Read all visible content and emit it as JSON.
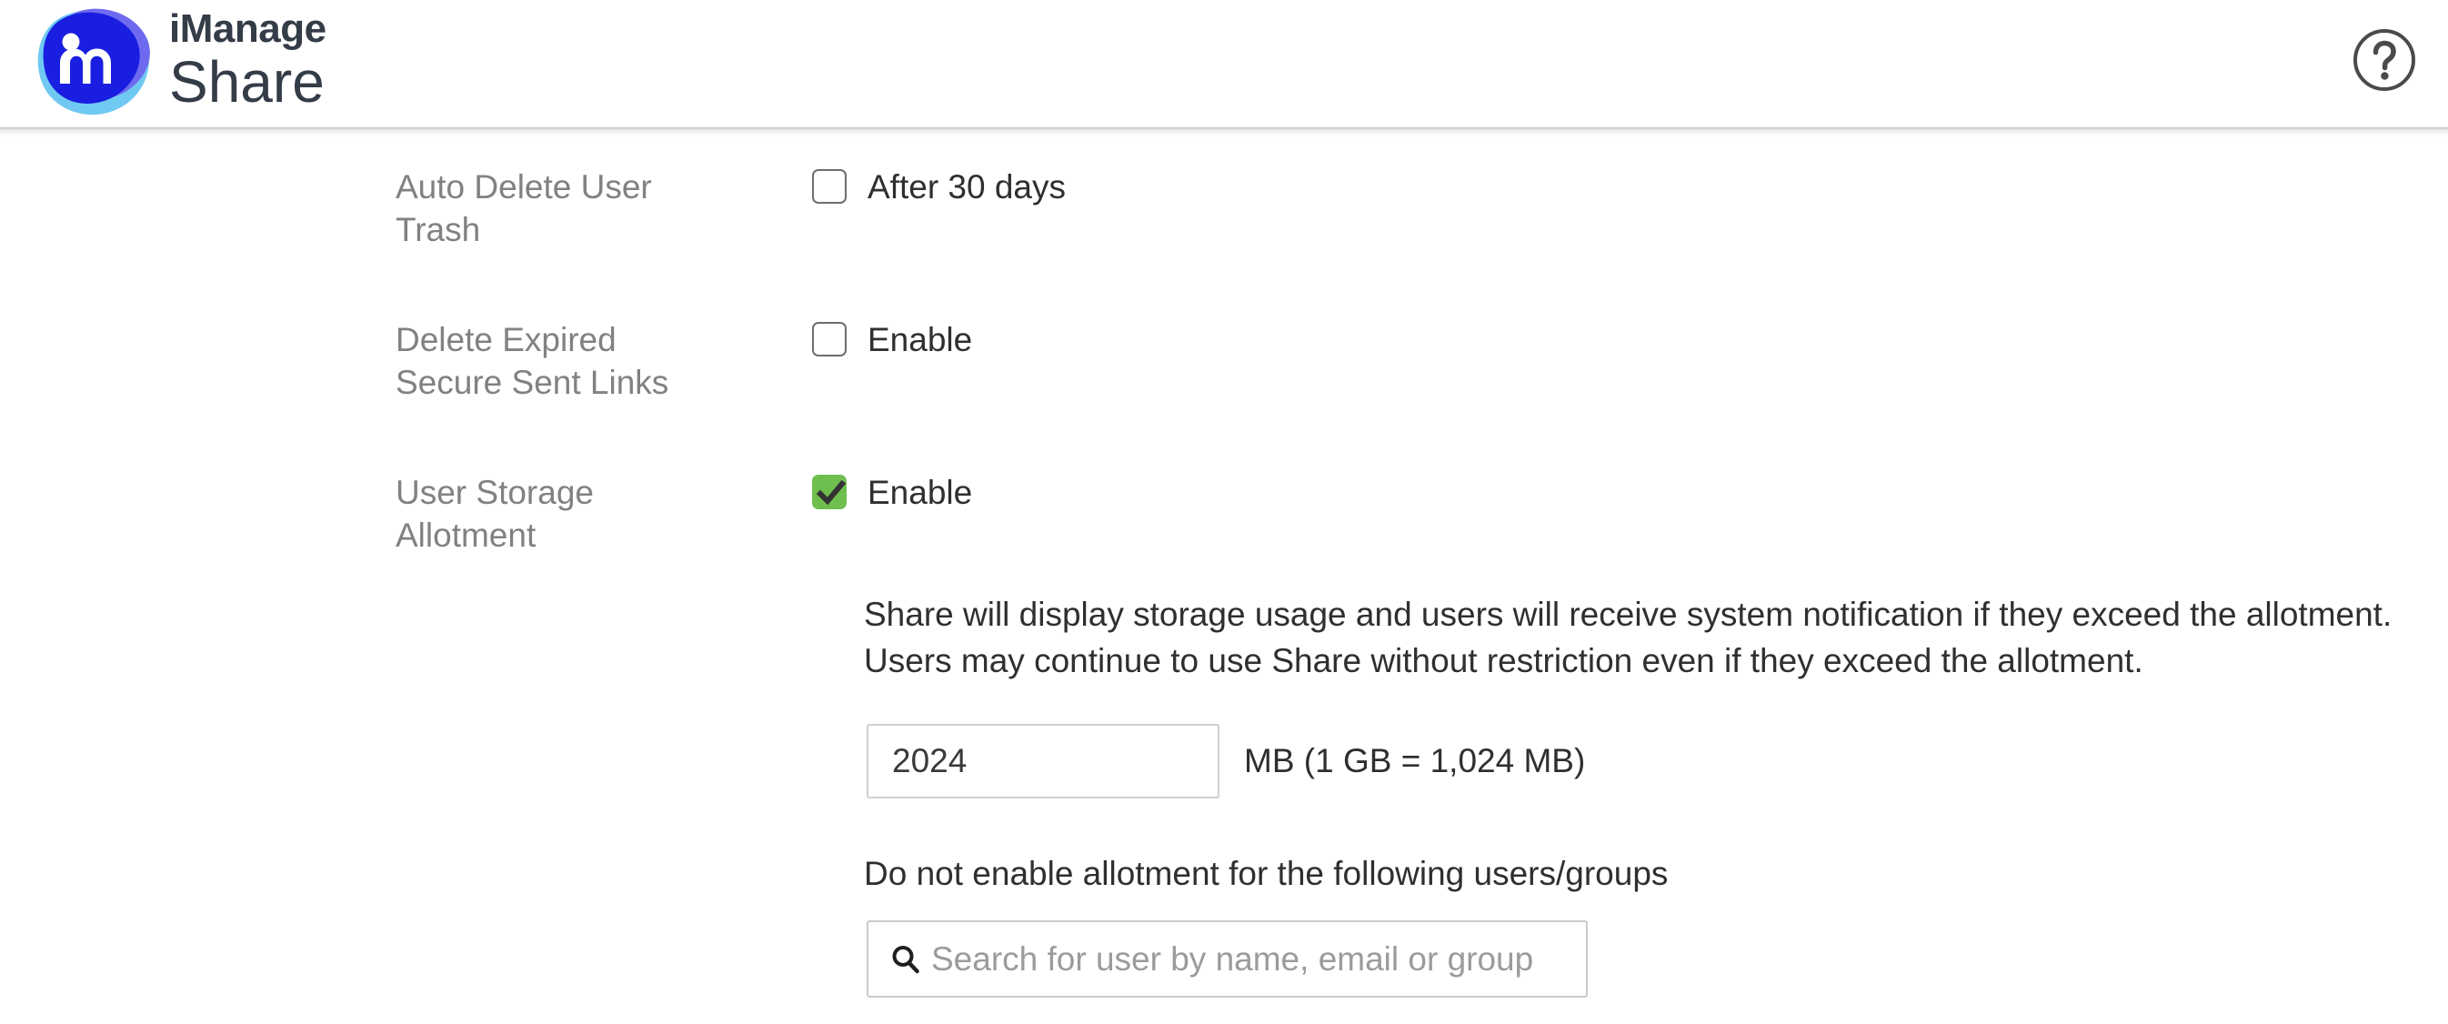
{
  "header": {
    "brand_line1": "iManage",
    "brand_line2": "Share",
    "logo_icon": "imanage-m-logo",
    "help_icon": "question-circle-icon",
    "help_label": "?"
  },
  "colors": {
    "brand_dark_blue": "#1a1ee0",
    "brand_light_blue": "#6fc9f2",
    "brand_purple": "#6e6af0",
    "brand_text": "#343c48",
    "label_gray": "#818181",
    "body_text": "#2f2f2f",
    "checkbox_checked_green": "#6fbf4f",
    "field_border": "#cacaca",
    "placeholder_gray": "#9b9b9b"
  },
  "settings": {
    "rows": [
      {
        "label": "Auto Delete User Trash",
        "checkbox_label": "After 30 days",
        "checked": false
      },
      {
        "label": "Delete Expired Secure Sent Links",
        "checkbox_label": "Enable",
        "checked": false
      },
      {
        "label": "User Storage Allotment",
        "checkbox_label": "Enable",
        "checked": true
      }
    ]
  },
  "allotment": {
    "description": "Share will display storage usage and users will receive system notification if they exceed the allotment. Users may continue to use Share without restriction even if they exceed the allotment.",
    "value": "2024",
    "unit_label": "MB (1 GB = 1,024 MB)",
    "exclusion_label": "Do not enable allotment for the following users/groups",
    "search_placeholder": "Search for user by name, email or group",
    "search_value": "",
    "search_icon": "search-icon"
  }
}
